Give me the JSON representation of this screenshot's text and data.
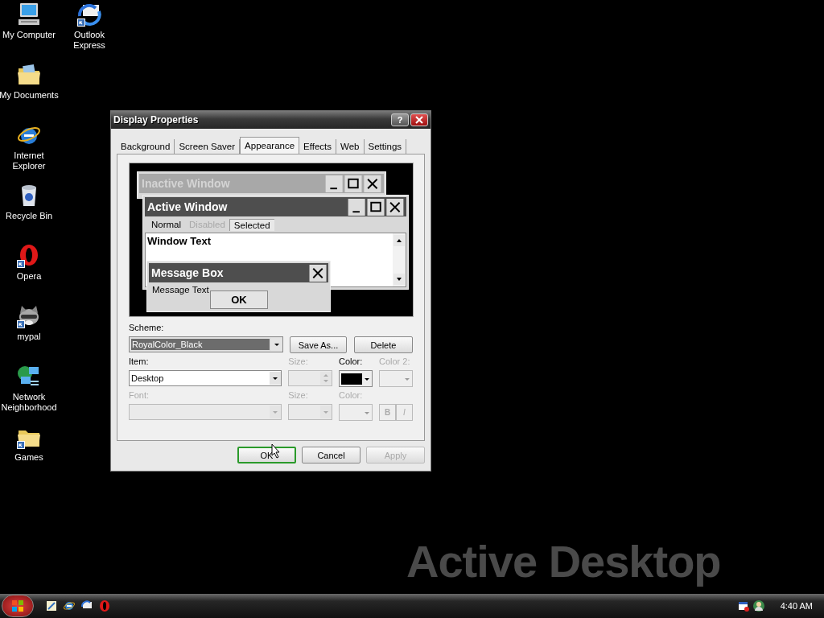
{
  "desktop_icons": [
    {
      "label": "My Computer",
      "kind": "computer",
      "shortcut": false
    },
    {
      "label": "My Documents",
      "kind": "documents",
      "shortcut": false
    },
    {
      "label": "Internet Explorer",
      "kind": "globe-e",
      "shortcut": false
    },
    {
      "label": "Recycle Bin",
      "kind": "bin",
      "shortcut": false
    },
    {
      "label": "Opera",
      "kind": "opera",
      "shortcut": true
    },
    {
      "label": "mypal",
      "kind": "raccoon",
      "shortcut": true
    },
    {
      "label": "Network Neighborhood",
      "kind": "network",
      "shortcut": false
    },
    {
      "label": "Games",
      "kind": "folder",
      "shortcut": true
    },
    {
      "label": "Outlook Express",
      "kind": "mail",
      "shortcut": true
    }
  ],
  "wallpaper_text": "Active Desktop",
  "dialog": {
    "title": "Display Properties",
    "help_button": "?",
    "tabs": [
      {
        "label": "Background",
        "selected": false
      },
      {
        "label": "Screen Saver",
        "selected": false
      },
      {
        "label": "Appearance",
        "selected": true
      },
      {
        "label": "Effects",
        "selected": false
      },
      {
        "label": "Web",
        "selected": false
      },
      {
        "label": "Settings",
        "selected": false
      }
    ],
    "preview": {
      "inactive_title": "Inactive Window",
      "active_title": "Active Window",
      "menu": [
        {
          "label": "Normal",
          "kind": "normal"
        },
        {
          "label": "Disabled",
          "kind": "disabled"
        },
        {
          "label": "Selected",
          "kind": "selected"
        }
      ],
      "window_text": "Window Text",
      "message_title": "Message Box",
      "message_text": "Message Text",
      "message_button": "OK"
    },
    "scheme": {
      "label": "Scheme:",
      "value": "RoyalColor_Black",
      "buttons": [
        "Save As...",
        "Delete"
      ]
    },
    "item": {
      "label": "Item:",
      "value": "Desktop",
      "disabled": false
    },
    "item_size": {
      "label": "Size:",
      "disabled": true
    },
    "item_color": {
      "label": "Color:",
      "color": "#000000",
      "disabled": false
    },
    "item_color2": {
      "label": "Color 2:",
      "disabled": true
    },
    "font": {
      "label": "Font:",
      "disabled": true
    },
    "font_size": {
      "label": "Size:",
      "disabled": true
    },
    "font_color": {
      "label": "Color:",
      "disabled": true
    },
    "style_buttons": [
      {
        "label": "B",
        "kind": "bold",
        "disabled": true
      },
      {
        "label": "I",
        "kind": "italic",
        "disabled": true
      }
    ],
    "buttons": [
      {
        "label": "OK",
        "focused": true,
        "disabled": false
      },
      {
        "label": "Cancel",
        "focused": false,
        "disabled": false
      },
      {
        "label": "Apply",
        "focused": false,
        "disabled": true
      }
    ]
  },
  "taskbar": {
    "quick_launch": [
      {
        "kind": "notepad"
      },
      {
        "kind": "globe-e"
      },
      {
        "kind": "mail"
      },
      {
        "kind": "opera"
      }
    ],
    "tray_icons": [
      {
        "kind": "calendar"
      },
      {
        "kind": "person"
      }
    ],
    "clock": "4:40 AM"
  }
}
